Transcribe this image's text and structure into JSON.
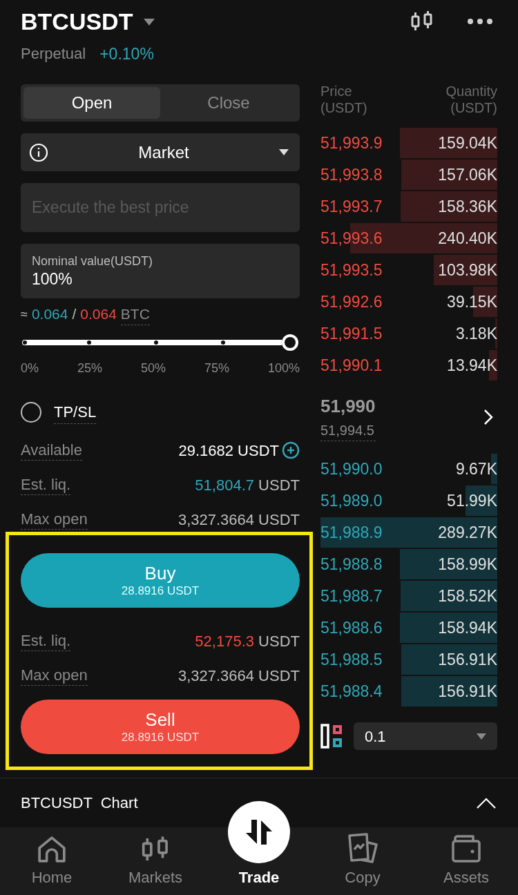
{
  "header": {
    "symbol": "BTCUSDT",
    "contract_type": "Perpetual",
    "change": "+0.10%"
  },
  "order_form": {
    "tabs": [
      {
        "label": "Open",
        "selected": true
      },
      {
        "label": "Close",
        "selected": false
      }
    ],
    "order_type": {
      "value": "Market"
    },
    "price_field": {
      "placeholder": "Execute the best price"
    },
    "nominal": {
      "label": "Nominal value(USDT)",
      "value": "100%"
    },
    "estimate": {
      "prefix": "≈",
      "buy": "0.064",
      "separator": "/",
      "sell": "0.064",
      "unit": "BTC"
    },
    "slider": {
      "level": 1,
      "marks": [
        "0%",
        "25%",
        "50%",
        "75%",
        "100%"
      ]
    },
    "tpsl": {
      "label": "TP/SL",
      "checked": false
    },
    "info_top": [
      {
        "label": "Available",
        "value": "29.1682 USDT",
        "kind": "available"
      },
      {
        "label": "Est. liq.",
        "value": "51,804.7",
        "unit": "USDT",
        "kind": "buy"
      },
      {
        "label": "Max open",
        "value": "3,327.3664 USDT",
        "kind": "plain"
      }
    ],
    "buy_button": {
      "label": "Buy",
      "amount": "28.8916 USDT"
    },
    "info_bottom": [
      {
        "label": "Est. liq.",
        "value": "52,175.3",
        "unit": "USDT",
        "kind": "sell"
      },
      {
        "label": "Max open",
        "value": "3,327.3664 USDT",
        "kind": "plain"
      }
    ],
    "sell_button": {
      "label": "Sell",
      "amount": "28.8916 USDT"
    }
  },
  "order_book": {
    "columns": [
      {
        "label": "Price",
        "unit": "(USDT)"
      },
      {
        "label": "Quantity",
        "unit": "(USDT)"
      }
    ],
    "asks": [
      {
        "price": "51,993.9",
        "quantity": "159.04K"
      },
      {
        "price": "51,993.8",
        "quantity": "157.06K"
      },
      {
        "price": "51,993.7",
        "quantity": "158.36K"
      },
      {
        "price": "51,993.6",
        "quantity": "240.40K"
      },
      {
        "price": "51,993.5",
        "quantity": "103.98K"
      },
      {
        "price": "51,992.6",
        "quantity": "39.15K"
      },
      {
        "price": "51,991.5",
        "quantity": "3.18K"
      },
      {
        "price": "51,990.1",
        "quantity": "13.94K"
      }
    ],
    "last_price": "51,990",
    "mark_price": "51,994.5",
    "bids": [
      {
        "price": "51,990.0",
        "quantity": "9.67K"
      },
      {
        "price": "51,989.0",
        "quantity": "51.99K"
      },
      {
        "price": "51,988.9",
        "quantity": "289.27K"
      },
      {
        "price": "51,988.8",
        "quantity": "158.99K"
      },
      {
        "price": "51,988.7",
        "quantity": "158.52K"
      },
      {
        "price": "51,988.6",
        "quantity": "158.94K"
      },
      {
        "price": "51,988.5",
        "quantity": "156.91K"
      },
      {
        "price": "51,988.4",
        "quantity": "156.91K"
      }
    ],
    "precision": "0.1"
  },
  "chart_bar": {
    "symbol": "BTCUSDT",
    "label": "Chart"
  },
  "nav": [
    {
      "label": "Home",
      "kind": "home",
      "selected": false
    },
    {
      "label": "Markets",
      "kind": "markets",
      "selected": false
    },
    {
      "label": "Trade",
      "kind": "trade",
      "selected": true
    },
    {
      "label": "Copy",
      "kind": "copy",
      "selected": false
    },
    {
      "label": "Assets",
      "kind": "assets",
      "selected": false
    }
  ]
}
